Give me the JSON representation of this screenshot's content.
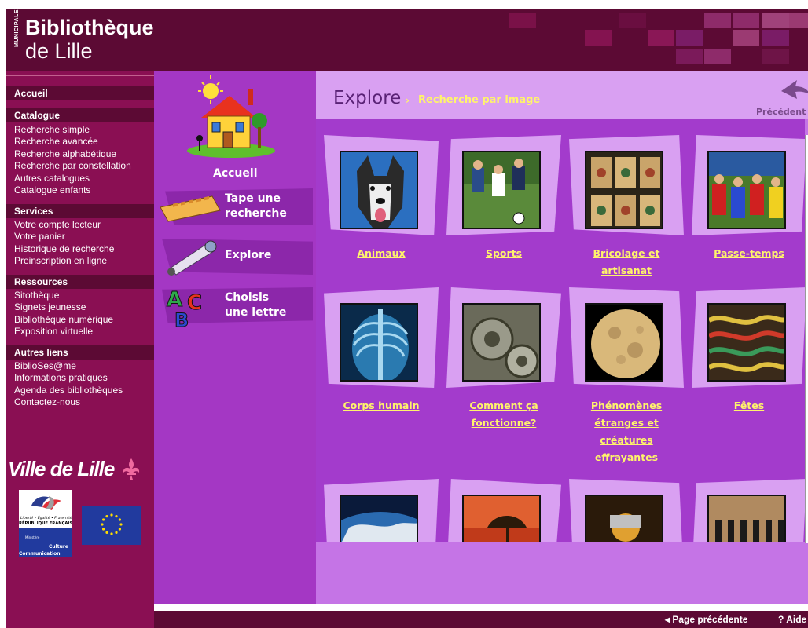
{
  "header": {
    "logo_small": "MUNICIPALE",
    "logo_line1": "Bibliothèque",
    "logo_line2": "de Lille"
  },
  "sidebar": {
    "accueil": "Accueil",
    "sections": [
      {
        "title": "Catalogue",
        "items": [
          "Recherche simple",
          "Recherche avancée",
          "Recherche alphabétique",
          "Recherche par constellation",
          "Autres catalogues",
          "Catalogue enfants"
        ]
      },
      {
        "title": "Services",
        "items": [
          "Votre compte lecteur",
          "Votre panier",
          "Historique de recherche",
          "Preinscription en ligne"
        ]
      },
      {
        "title": "Ressources",
        "items": [
          "Sitothèque",
          "Signets jeunesse",
          "Bibliothèque numérique",
          "Exposition virtuelle"
        ]
      },
      {
        "title": "Autres liens",
        "items": [
          "BiblioSes@me",
          "Informations pratiques",
          "Agenda des bibliothèques",
          "Contactez-nous"
        ]
      }
    ],
    "ville_logo": "Ville de Lille",
    "marianne_text": [
      "Liberté • Égalité • Fraternité",
      "RÉPUBLIQUE FRANÇAISE",
      "Ministère",
      "Culture",
      "Communication"
    ]
  },
  "nav": {
    "home": "Accueil",
    "type_search": [
      "Tape une",
      "recherche"
    ],
    "explore": "Explore",
    "choose_letter": [
      "Choisis",
      "une lettre"
    ]
  },
  "content": {
    "title": "Explore",
    "arrow": "›",
    "subtitle": "Recherche par image",
    "prev_top": "Précédent",
    "cards": [
      {
        "lines": [
          "Animaux"
        ]
      },
      {
        "lines": [
          "Sports"
        ]
      },
      {
        "lines": [
          "Bricolage et",
          "artisanat"
        ]
      },
      {
        "lines": [
          "Passe-temps"
        ]
      },
      {
        "lines": [
          "Corps humain"
        ]
      },
      {
        "lines": [
          "Comment ça",
          "fonctionne?"
        ]
      },
      {
        "lines": [
          "Phénomènes",
          "étranges et",
          "créatures",
          "effrayantes"
        ]
      },
      {
        "lines": [
          "Fêtes"
        ]
      },
      {
        "lines": []
      },
      {
        "lines": []
      },
      {
        "lines": []
      },
      {
        "lines": []
      }
    ]
  },
  "footer": {
    "prev": "◂ Page précédente",
    "help": "? Aide"
  },
  "colors": {
    "header_bg": "#5c0a34",
    "sidebar_bg": "#8a0f53",
    "nav_bg": "#a437c4",
    "content_bg": "#c574e6",
    "caption": "#fff46b"
  }
}
